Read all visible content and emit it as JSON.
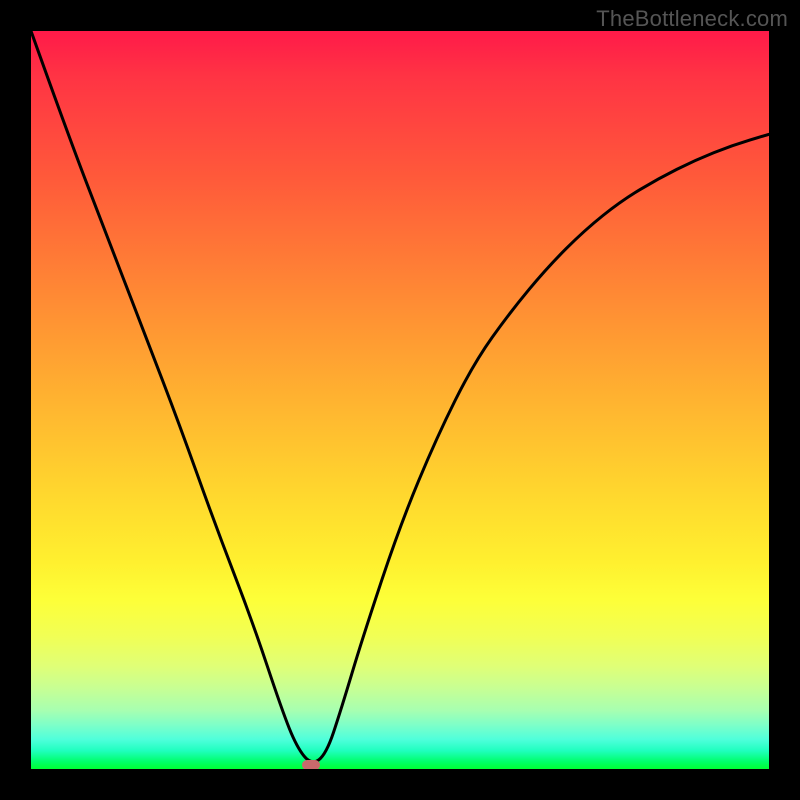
{
  "watermark": "TheBottleneck.com",
  "colors": {
    "page_bg": "#000000",
    "curve": "#000000",
    "marker": "#c96a6c",
    "gradient_stops": [
      "#ff1a49",
      "#ff3344",
      "#ff5a3a",
      "#ff8a34",
      "#ffb330",
      "#ffd82e",
      "#fff02f",
      "#fdff38",
      "#f1ff55",
      "#e0ff76",
      "#c8ff93",
      "#a8ffb0",
      "#7effc8",
      "#4fffdb",
      "#20ffbf",
      "#00ff6a",
      "#00ff33"
    ]
  },
  "chart_data": {
    "type": "line",
    "title": "",
    "xlabel": "",
    "ylabel": "",
    "xlim": [
      0,
      100
    ],
    "ylim": [
      0,
      100
    ],
    "series": [
      {
        "name": "bottleneck-curve",
        "x": [
          0,
          5,
          10,
          15,
          20,
          25,
          30,
          34,
          36,
          38,
          40,
          42,
          45,
          50,
          55,
          60,
          65,
          70,
          75,
          80,
          85,
          90,
          95,
          100
        ],
        "y": [
          100,
          86,
          73,
          60,
          47,
          33,
          20,
          8,
          3,
          0.5,
          2,
          8,
          18,
          33,
          45,
          55,
          62,
          68,
          73,
          77,
          80,
          82.5,
          84.5,
          86
        ]
      }
    ],
    "marker": {
      "name": "bottleneck-point",
      "x": 38,
      "y": 0.5
    },
    "grid": false,
    "legend": false
  }
}
